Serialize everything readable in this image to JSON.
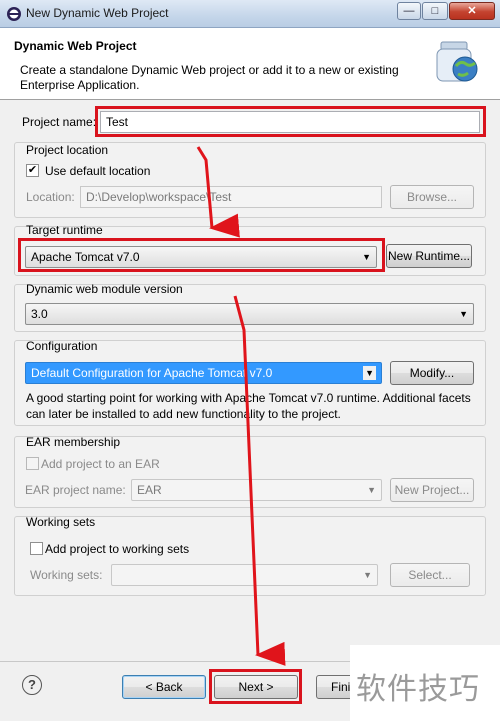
{
  "window": {
    "title": "New Dynamic Web Project",
    "minimize": "—",
    "maximize": "□",
    "close": "✕"
  },
  "header": {
    "title": "Dynamic Web Project",
    "description": "Create a standalone Dynamic Web project or add it to a new or existing Enterprise Application."
  },
  "project_name": {
    "label": "Project name:",
    "value": "Test"
  },
  "project_location": {
    "group_label": "Project location",
    "use_default_label": "Use default location",
    "use_default_checked": true,
    "location_label": "Location:",
    "location_value": "D:\\Develop\\workspace\\Test",
    "browse_label": "Browse..."
  },
  "target_runtime": {
    "group_label": "Target runtime",
    "value": "Apache Tomcat v7.0",
    "new_runtime_label": "New Runtime..."
  },
  "module_version": {
    "group_label": "Dynamic web module version",
    "value": "3.0"
  },
  "configuration": {
    "group_label": "Configuration",
    "value": "Default Configuration for Apache Tomcat v7.0",
    "modify_label": "Modify...",
    "hint": "A good starting point for working with Apache Tomcat v7.0 runtime. Additional facets can later be installed to add new functionality to the project."
  },
  "ear": {
    "group_label": "EAR membership",
    "add_label": "Add project to an EAR",
    "add_checked": false,
    "project_name_label": "EAR project name:",
    "project_name_value": "EAR",
    "new_project_label": "New Project..."
  },
  "working_sets": {
    "group_label": "Working sets",
    "add_label": "Add project to working sets",
    "add_checked": false,
    "sets_label": "Working sets:",
    "sets_value": "",
    "select_label": "Select..."
  },
  "footer": {
    "help": "?",
    "back_label": "< Back",
    "next_label": "Next >",
    "finish_label": "Finis"
  },
  "watermark": "软件技巧",
  "colors": {
    "highlight": "#d9131d",
    "annotation_arrow": "#e0141b"
  }
}
